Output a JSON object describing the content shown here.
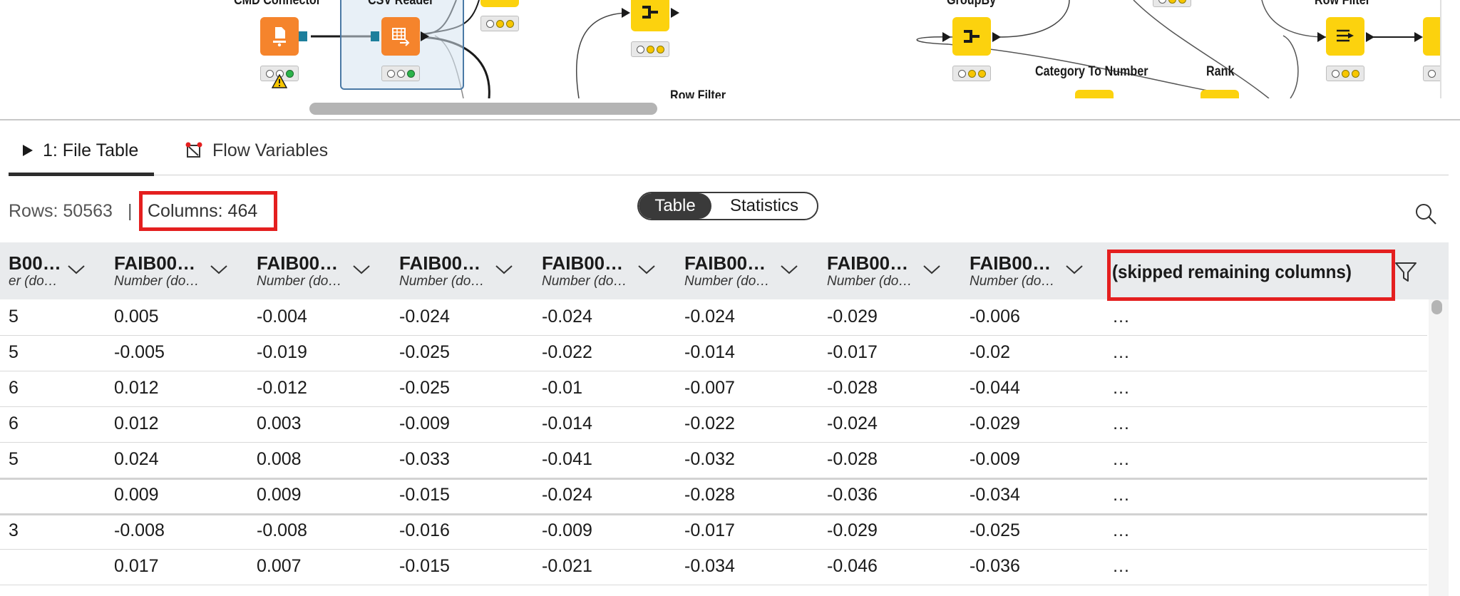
{
  "canvas": {
    "nodes": [
      {
        "label": "CMD Connector"
      },
      {
        "label": "CSV Reader"
      },
      {
        "label": "GroupBy"
      },
      {
        "label": "Row Filter"
      },
      {
        "label": "Category To Number"
      },
      {
        "label": "Rank"
      },
      {
        "label": "Row Filter"
      }
    ]
  },
  "tabs": [
    {
      "label": "1: File Table"
    },
    {
      "label": "Flow Variables"
    }
  ],
  "info": {
    "rows": "Rows: 50563",
    "separator": "|",
    "columns": "Columns: 464"
  },
  "view_toggle": {
    "options": [
      "Table",
      "Statistics"
    ],
    "selected": "Table"
  },
  "table": {
    "columns": [
      {
        "name": "FAIB00…",
        "type": "Number (do…"
      },
      {
        "name": "FAIB00…",
        "type": "Number (do…"
      },
      {
        "name": "FAIB00…",
        "type": "Number (do…"
      },
      {
        "name": "FAIB00…",
        "type": "Number (do…"
      },
      {
        "name": "FAIB00…",
        "type": "Number (do…"
      },
      {
        "name": "FAIB00…",
        "type": "Number (do…"
      },
      {
        "name": "FAIB00…",
        "type": "Number (do…"
      },
      {
        "name": "FAIB00…",
        "type": "Number (do…"
      }
    ],
    "partial_column": {
      "name": "B00…",
      "type": "er (do…"
    },
    "skipped_label": "(skipped remaining columns)",
    "rows": [
      {
        "partial": "5",
        "cells": [
          "0.005",
          "-0.004",
          "-0.024",
          "-0.024",
          "-0.024",
          "-0.029",
          "-0.006",
          "…"
        ]
      },
      {
        "partial": "5",
        "cells": [
          "-0.005",
          "-0.019",
          "-0.025",
          "-0.022",
          "-0.014",
          "-0.017",
          "-0.02",
          "…"
        ]
      },
      {
        "partial": "6",
        "cells": [
          "0.012",
          "-0.012",
          "-0.025",
          "-0.01",
          "-0.007",
          "-0.028",
          "-0.044",
          "…"
        ]
      },
      {
        "partial": "6",
        "cells": [
          "0.012",
          "0.003",
          "-0.009",
          "-0.014",
          "-0.022",
          "-0.024",
          "-0.029",
          "…"
        ]
      },
      {
        "partial": "5",
        "cells": [
          "0.024",
          "0.008",
          "-0.033",
          "-0.041",
          "-0.032",
          "-0.028",
          "-0.009",
          "…"
        ]
      },
      {
        "partial": "",
        "cells": [
          "0.009",
          "0.009",
          "-0.015",
          "-0.024",
          "-0.028",
          "-0.036",
          "-0.034",
          "…"
        ]
      },
      {
        "partial": "3",
        "cells": [
          "-0.008",
          "-0.008",
          "-0.016",
          "-0.009",
          "-0.017",
          "-0.029",
          "-0.025",
          "…"
        ]
      },
      {
        "partial": "",
        "cells": [
          "0.017",
          "0.007",
          "-0.015",
          "-0.021",
          "-0.034",
          "-0.046",
          "-0.036",
          "…"
        ]
      }
    ]
  },
  "colors": {
    "highlight": "#e41f1f",
    "node_orange": "#f5842c",
    "node_yellow": "#fcd20e",
    "header_bg": "#e9ebed"
  }
}
